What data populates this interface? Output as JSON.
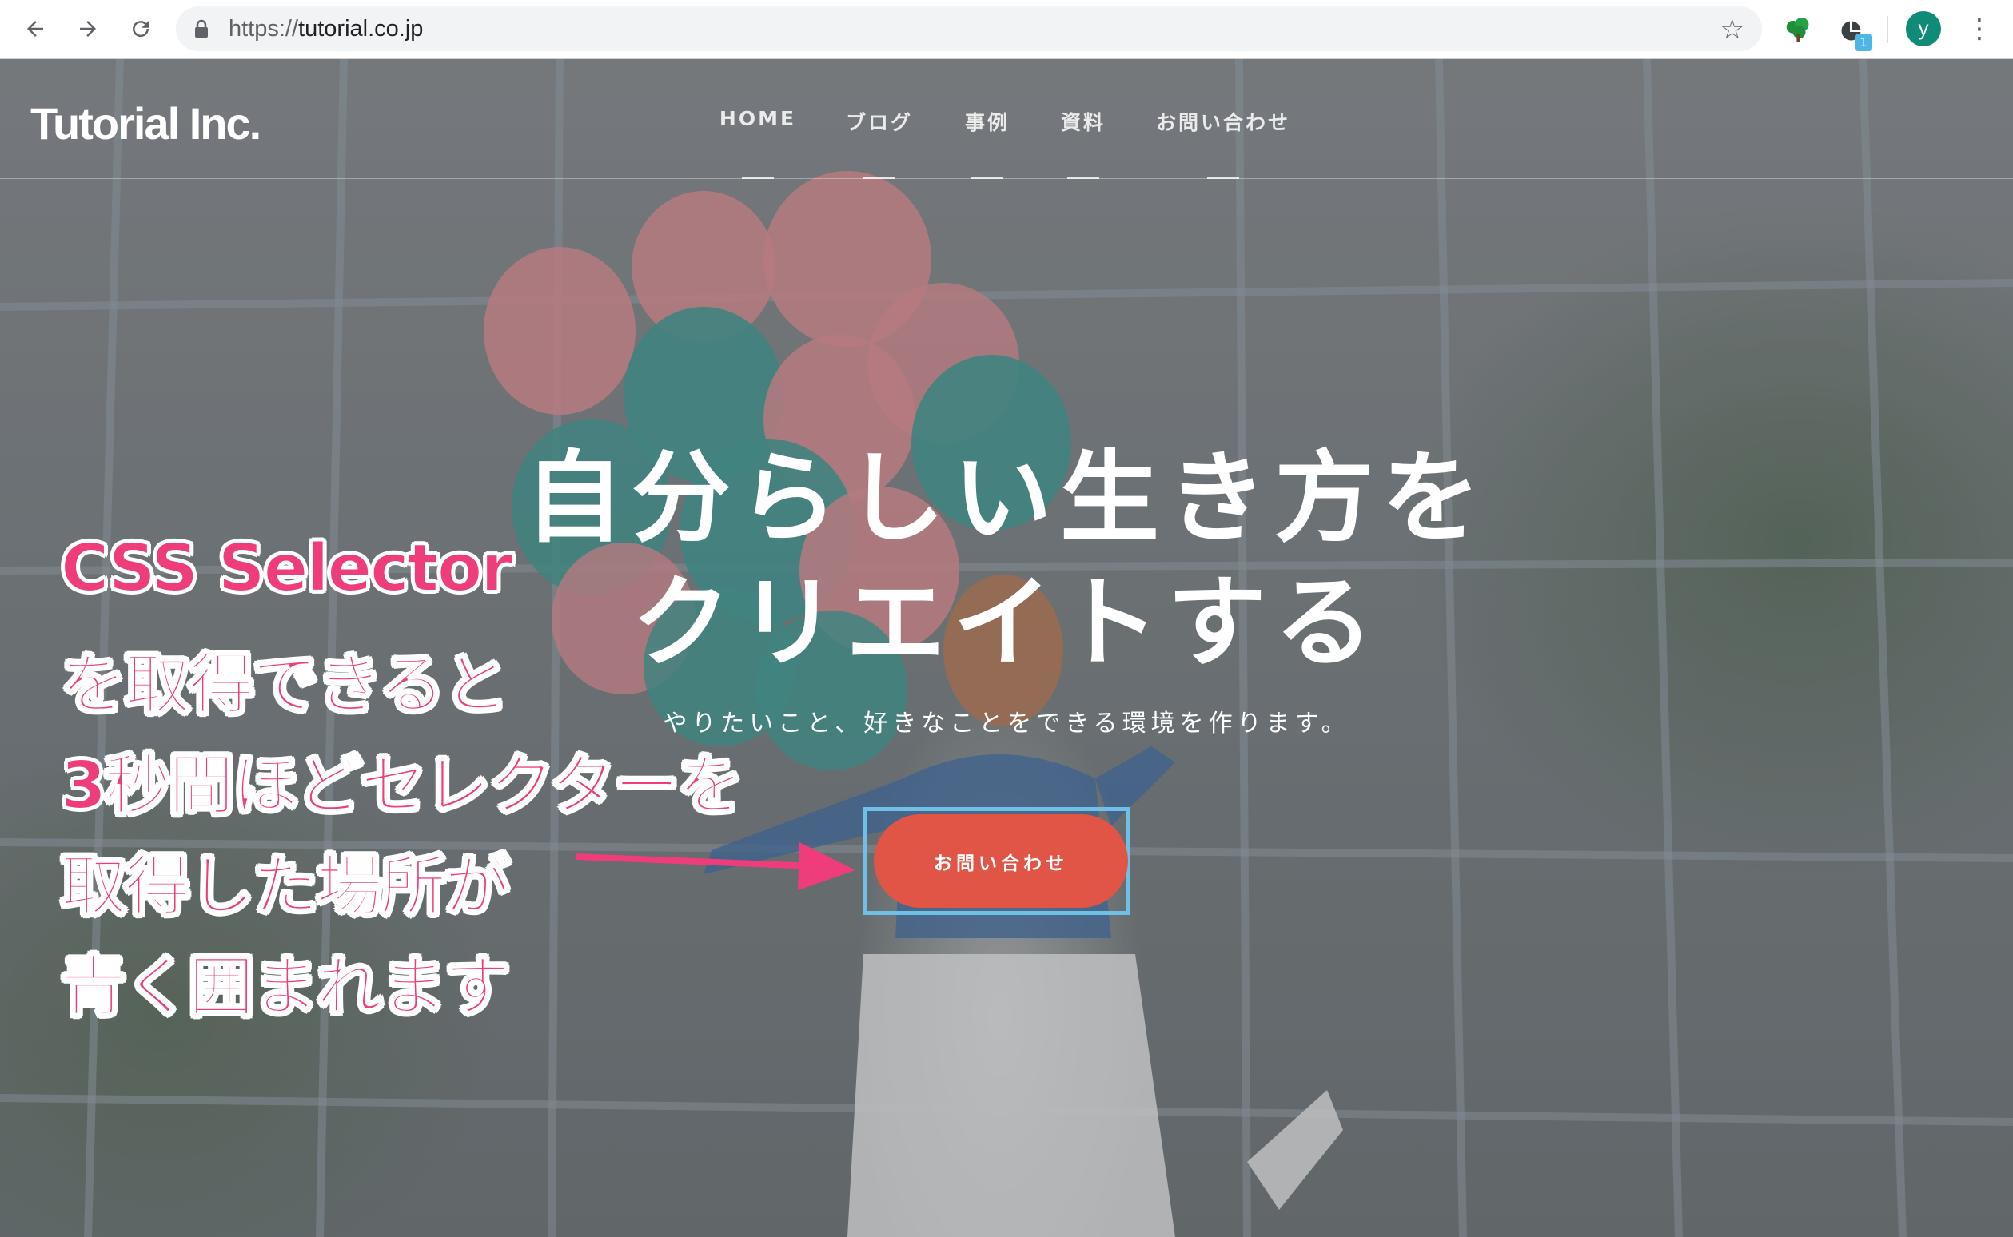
{
  "browser": {
    "url_scheme": "https://",
    "url_host": "tutorial.co.jp",
    "profile_initial": "y",
    "extension_badge": "1"
  },
  "site": {
    "logo": "Tutorial Inc.",
    "nav": [
      "HOME",
      "ブログ",
      "事例",
      "資料",
      "お問い合わせ"
    ]
  },
  "hero": {
    "title_line1": "自分らしい生き方を",
    "title_line2": "クリエイトする",
    "subtitle": "やりたいこと、好きなことをできる環境を作ります。",
    "cta_label": "お問い合わせ"
  },
  "annotation": {
    "lines": [
      "CSS Selector",
      "を取得できると",
      "3秒間ほどセレクターを",
      "取得した場所が",
      "青く囲まれます"
    ],
    "color": "#ee3d7a"
  },
  "colors": {
    "cta": "#e05545",
    "highlight_border": "#6fc0e6",
    "avatar": "#0f8b78"
  }
}
